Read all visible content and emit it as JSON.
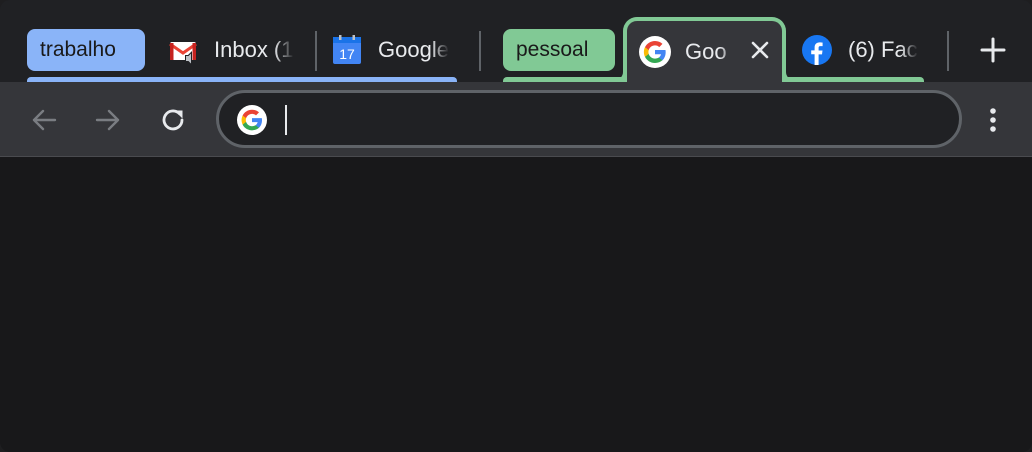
{
  "tab_groups": {
    "work": {
      "label": "trabalho",
      "color": "#8ab4f8"
    },
    "personal": {
      "label": "pessoal",
      "color": "#81c995"
    }
  },
  "tabs": [
    {
      "title": "Inbox (1",
      "icon": "gmail-icon",
      "group": "work",
      "audio": true
    },
    {
      "title": "Google",
      "icon": "calendar-icon",
      "icon_text": "17",
      "group": "work"
    },
    {
      "title": "Goo",
      "icon": "google-icon",
      "group": "personal",
      "active": true
    },
    {
      "title": "(6) Fac",
      "icon": "facebook-icon",
      "group": "personal"
    }
  ],
  "omnibox": {
    "value": "",
    "placeholder": ""
  },
  "colors": {
    "titlebar": "#202124",
    "toolbar": "#35363a",
    "page": "#18181a",
    "text": "#e8eaed"
  }
}
